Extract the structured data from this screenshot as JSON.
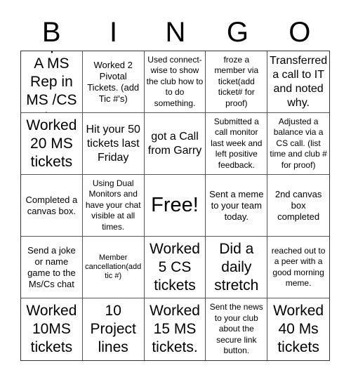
{
  "header": {
    "letters": [
      "B",
      "I",
      "N",
      "G",
      "O"
    ]
  },
  "cells": [
    {
      "text": "Helped A MS Rep in MS /CS Chat.",
      "size": "l"
    },
    {
      "text": "Worked 2 Pivotal Tickets. (add Tic #'s)",
      "size": "s"
    },
    {
      "text": "Used connect-wise to show the club how to to do something.",
      "size": "xs"
    },
    {
      "text": "froze a member via ticket(add ticket# for proof)",
      "size": "xs"
    },
    {
      "text": "Transferred a call to IT and noted why.",
      "size": "m"
    },
    {
      "text": "Worked 20 MS tickets",
      "size": "l"
    },
    {
      "text": "Hit your 50 tickets last Friday",
      "size": "m"
    },
    {
      "text": "got a Call from Garry",
      "size": "m"
    },
    {
      "text": "Submitted a call monitor last week and left positive feedback.",
      "size": "xs"
    },
    {
      "text": "Adjusted a balance via a CS call. (list time and club # for proof)",
      "size": "xs"
    },
    {
      "text": "Completed a canvas box.",
      "size": "s"
    },
    {
      "text": "Using Dual Monitors and have your chat visible at all times.",
      "size": "xs"
    },
    {
      "text": "Free!",
      "size": "xl"
    },
    {
      "text": "Sent a meme to your team today.",
      "size": "s"
    },
    {
      "text": "2nd canvas box completed",
      "size": "s"
    },
    {
      "text": "Send a joke or name game to the Ms/Cs chat",
      "size": "s"
    },
    {
      "text": "Member cancellation(add tic #)",
      "size": "xxs"
    },
    {
      "text": "Worked 5 CS tickets",
      "size": "l"
    },
    {
      "text": "Did a daily stretch",
      "size": "l"
    },
    {
      "text": "reached out to a peer with a good morning meme.",
      "size": "xs"
    },
    {
      "text": "Worked 10MS tickets",
      "size": "l"
    },
    {
      "text": "10 Project lines",
      "size": "l"
    },
    {
      "text": "Worked 15 MS tickets.",
      "size": "l"
    },
    {
      "text": "Sent the news to your club about the secure link button.",
      "size": "xs"
    },
    {
      "text": "Worked 40 Ms tickets",
      "size": "l"
    }
  ]
}
